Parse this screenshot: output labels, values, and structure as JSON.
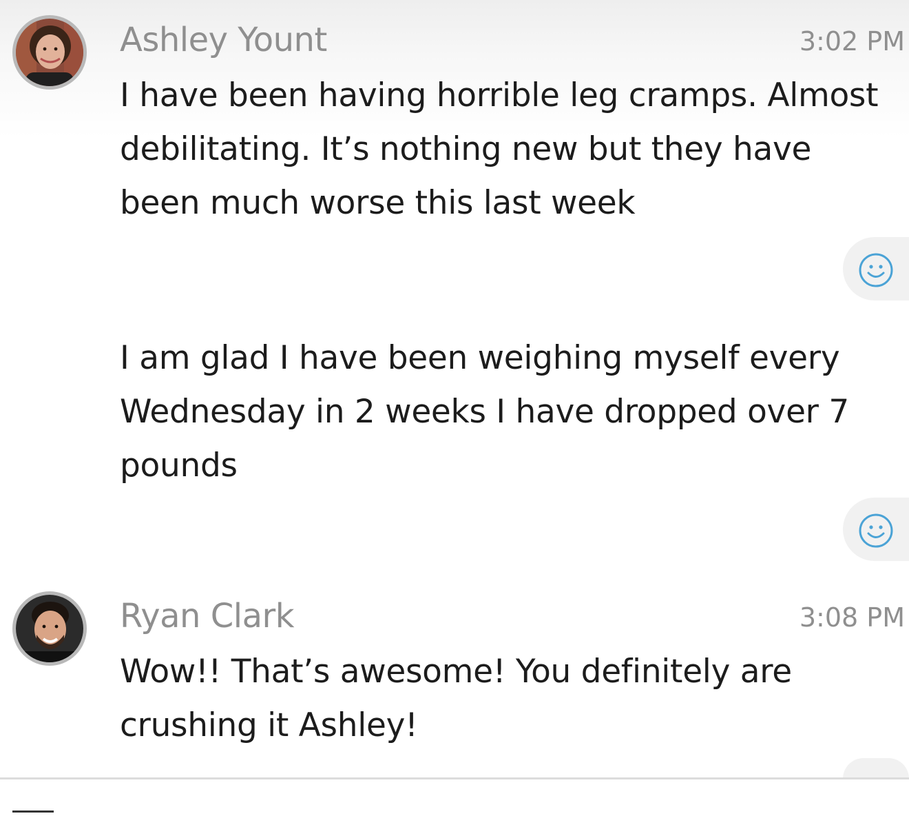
{
  "messages": [
    {
      "sender": "Ashley Yount",
      "time": "3:02 PM",
      "bubbles": [
        "I have been having horrible leg cramps. Almost debilitating. It’s nothing new but they have been much worse this last week",
        "I am glad I have been weighing myself every Wednesday in 2 weeks I have dropped over 7 pounds"
      ]
    },
    {
      "sender": "Ryan Clark",
      "time": "3:08 PM",
      "bubbles": [
        "Wow!! That’s awesome! You definitely are crushing it Ashley!"
      ]
    }
  ],
  "icons": {
    "reaction": "smiley-face-icon",
    "avatar": "avatar-photo"
  },
  "colors": {
    "reaction_icon": "#4ba3d6",
    "sender_name": "#8f8f8f",
    "message_text": "#1c1c1c"
  }
}
